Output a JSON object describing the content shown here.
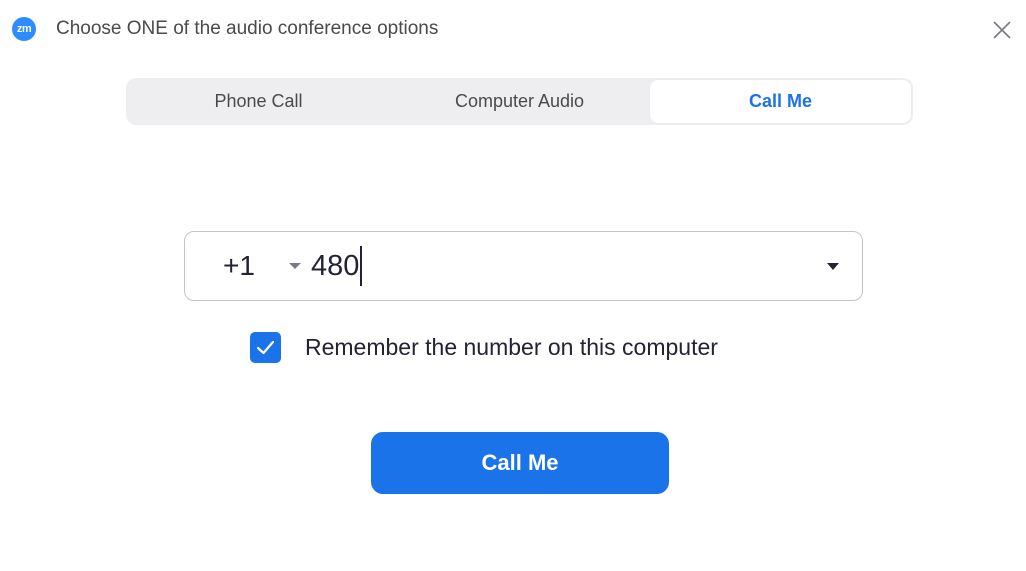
{
  "window": {
    "app_icon_text": "zm",
    "title": "Choose ONE of the audio conference options"
  },
  "tabs": [
    {
      "label": "Phone Call",
      "active": false
    },
    {
      "label": "Computer Audio",
      "active": false
    },
    {
      "label": "Call Me",
      "active": true
    }
  ],
  "phone": {
    "country_code": "+1",
    "number": "480"
  },
  "remember": {
    "checked": true,
    "label": "Remember the number on this computer"
  },
  "actions": {
    "call_label": "Call Me"
  },
  "icons": {
    "close": "close-icon",
    "country_dropdown": "chevron-down-icon",
    "number_dropdown": "chevron-down-icon",
    "check": "checkmark-icon"
  },
  "colors": {
    "accent": "#1a73e8",
    "app_icon": "#2d8cff",
    "tab_background": "#eeeef1",
    "text": "#232333"
  }
}
